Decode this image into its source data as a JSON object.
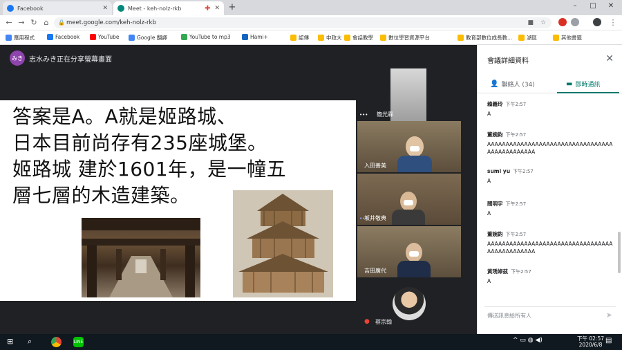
{
  "browser": {
    "tabs": [
      {
        "title": "Facebook",
        "color": "#1877f2"
      },
      {
        "title": "Meet - keh-nolz-rkb",
        "color": "#00897b"
      }
    ],
    "new_tab": "+",
    "url": "meet.google.com/keh-nolz-rkb",
    "window_controls": [
      "–",
      "□",
      "✕"
    ],
    "bookmarks": [
      {
        "label": "應用程式",
        "color": "#4285f4"
      },
      {
        "label": "Facebook",
        "color": "#1877f2"
      },
      {
        "label": "YouTube",
        "color": "#ff0000"
      },
      {
        "label": "Google 翻譯",
        "color": "#4285f4"
      },
      {
        "label": "YouTube to mp3",
        "color": "#34a853"
      },
      {
        "label": "Hami+",
        "color": "#1565c0"
      },
      {
        "label": "認傳",
        "color": "#fbbc04"
      },
      {
        "label": "中政大",
        "color": "#fbbc04"
      },
      {
        "label": "會話教學",
        "color": "#fbbc04"
      },
      {
        "label": "數位學習資源平台",
        "color": "#fbbc04"
      },
      {
        "label": "教育部數位成長教...",
        "color": "#fbbc04"
      },
      {
        "label": "湖區",
        "color": "#fbbc04"
      },
      {
        "label": "其他書籤",
        "color": "#fbbc04"
      }
    ]
  },
  "meet": {
    "presenter_initials": "みき",
    "presenter_text": "志水みき正在分享螢幕畫面",
    "slide_lines": [
      "答案是A。A就是姬路城、",
      "日本目前尚存有235座城堡。",
      "姬路城 建於1601年，是一幢五",
      "層七層的木造建築。"
    ],
    "participants": [
      {
        "name": "簡光霖"
      },
      {
        "name": "入田善美"
      },
      {
        "name": "坂井敬典"
      },
      {
        "name": "吉田廣代"
      }
    ],
    "self_name": "蔡宗翰"
  },
  "panel": {
    "title": "會議詳細資料",
    "tab_people": "聯絡人 (34)",
    "tab_chat": "即時通訊",
    "messages": [
      {
        "name": "賴義玲",
        "time": "下午2:57",
        "text": "A"
      },
      {
        "name": "董婉鈞",
        "time": "下午2:57",
        "text": "AAAAAAAAAAAAAAAAAAAAAAAAAAAAAAAAAAAAAAAAAAAAAAA"
      },
      {
        "name": "sumi yu",
        "time": "下午2:57",
        "text": "A"
      },
      {
        "name": "閻明宇",
        "time": "下午2:57",
        "text": "A"
      },
      {
        "name": "董婉鈞",
        "time": "下午2:57",
        "text": "AAAAAAAAAAAAAAAAAAAAAAAAAAAAAAAAAAAAAAAAAAAAAAA"
      },
      {
        "name": "黃琇婷茲",
        "time": "下午2:57",
        "text": "A"
      }
    ],
    "chat_placeholder": "傳送訊息給所有人"
  },
  "taskbar": {
    "time": "下午 02:57",
    "date": "2020/6/8"
  }
}
